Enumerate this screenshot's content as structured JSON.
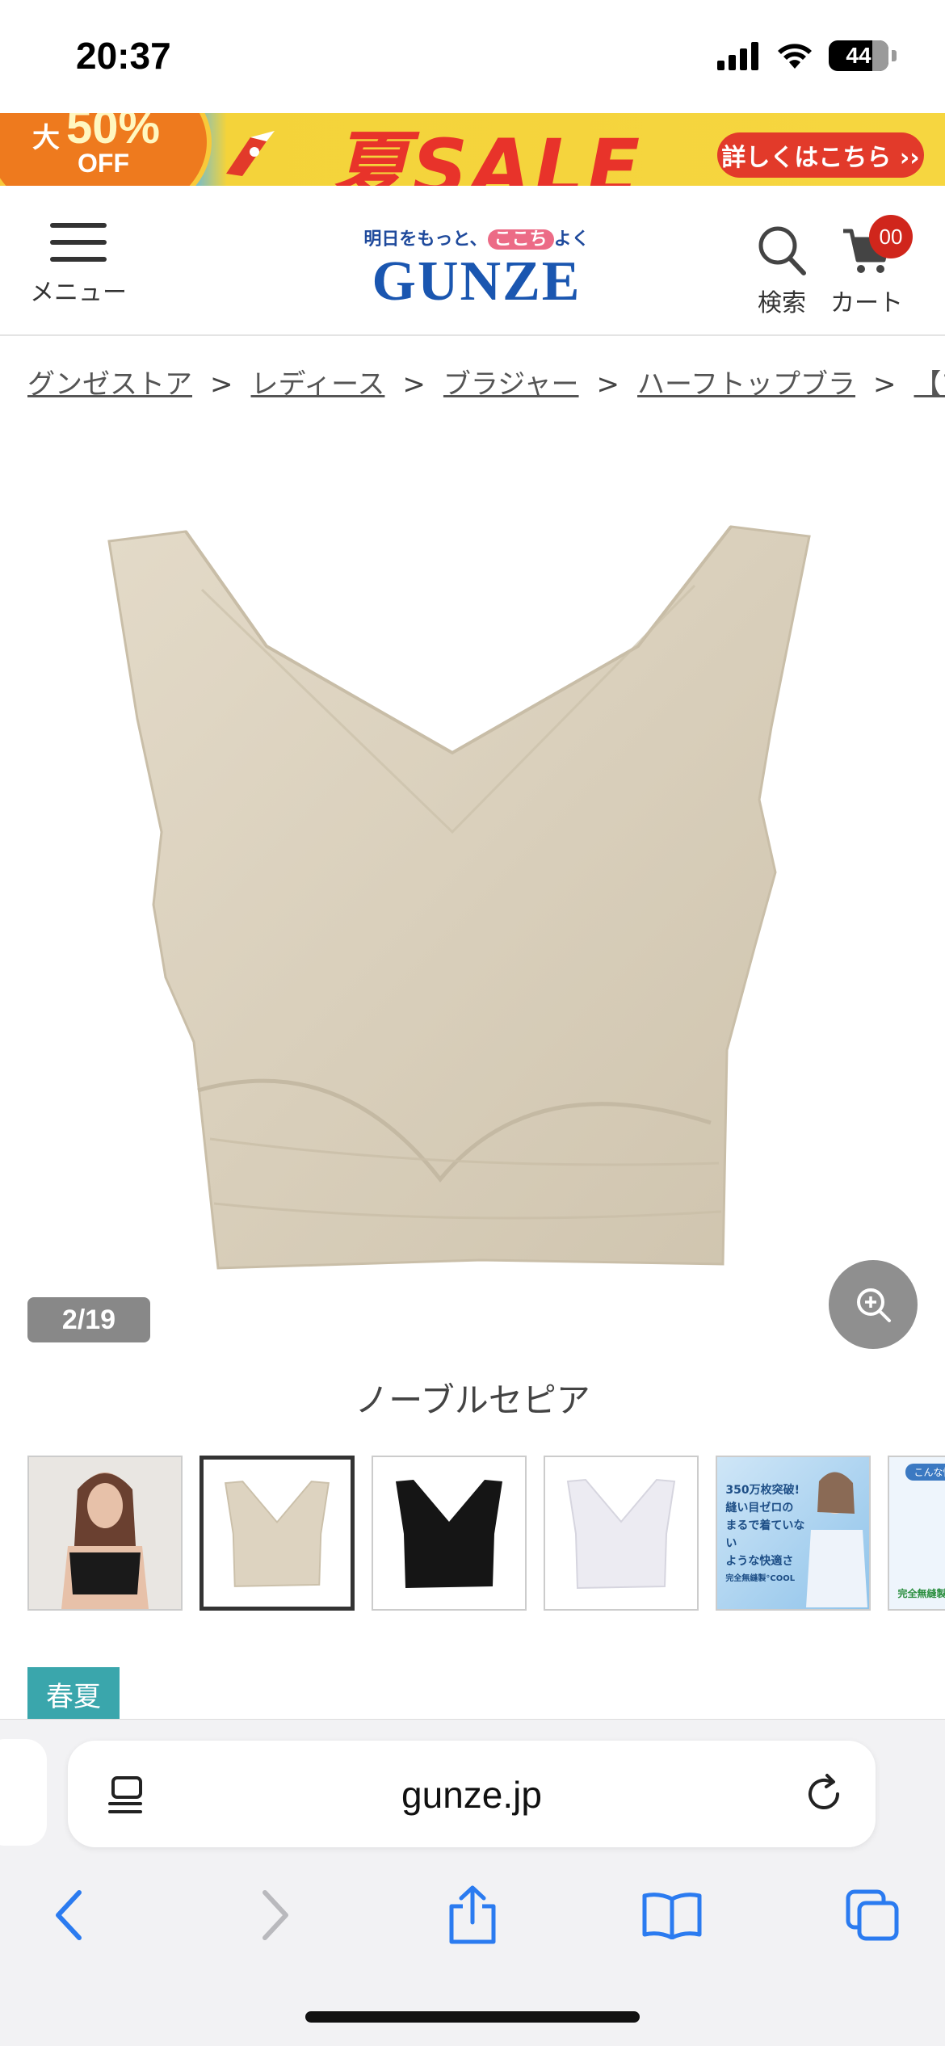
{
  "status_bar": {
    "time": "20:37",
    "battery": "44"
  },
  "sale_banner": {
    "percent": "50%",
    "off": "OFF",
    "prefix": "大",
    "title": "夏SALE",
    "cta": "詳しくはこちら ››"
  },
  "header": {
    "menu_label": "メニュー",
    "logo_tagline_a": "明日をもっと、",
    "logo_tagline_b": "ここち",
    "logo_tagline_c": "よく",
    "logo_word": "GUNZE",
    "search_label": "検索",
    "cart_label": "カート",
    "cart_count": "00"
  },
  "breadcrumb": {
    "items": [
      "グンゼストア",
      "レディース",
      "ブラジャー",
      "ハーフトップブラ",
      "【ひんやり"
    ],
    "separator": ">"
  },
  "product": {
    "image_counter": "2/19",
    "color_name": "ノーブルセピア",
    "thumbnails": [
      {
        "label": "model-black"
      },
      {
        "label": "sepia-bra"
      },
      {
        "label": "black-bra"
      },
      {
        "label": "white-bra"
      },
      {
        "label": "promo-350",
        "promo_lines": [
          "350万枚突破!",
          "縫い目ゼロの",
          "まるで着ていない",
          "ような快適さ",
          "完全無縫製°COOL"
        ]
      },
      {
        "label": "promo-2",
        "promo_lines": [
          "こんな悩み",
          "完全無縫製°C"
        ]
      }
    ],
    "season_badge": "春夏"
  },
  "browser": {
    "url": "gunze.jp"
  },
  "colors": {
    "accent_red": "#d0261c",
    "teal": "#3aa6ac",
    "brand_blue": "#1a56b0",
    "sepia": "#ddd3c0"
  }
}
